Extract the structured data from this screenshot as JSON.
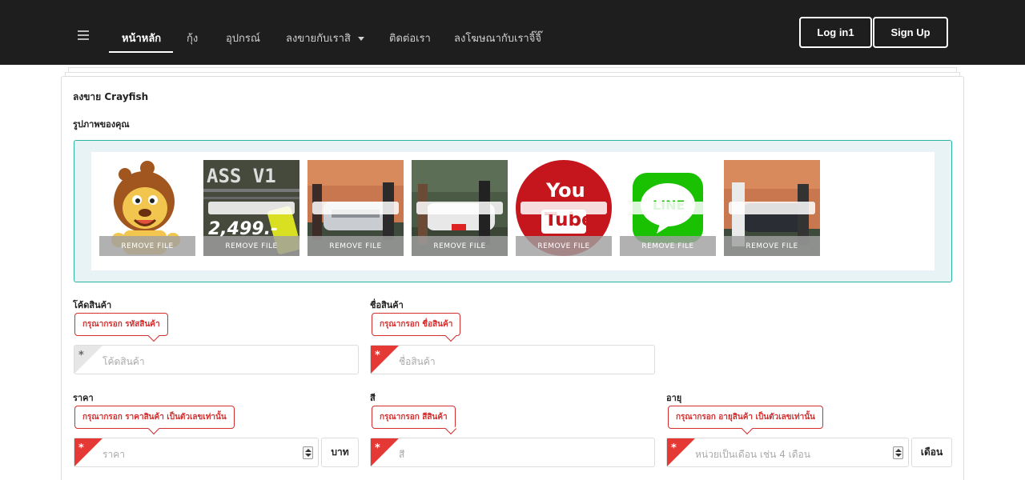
{
  "nav": {
    "items": [
      "หน้าหลัก",
      "กุ้ง",
      "อุปกรณ์",
      "ลงขายกับเราสิ",
      "ติดต่อเรา",
      "ลงโฆษณากับเราจิ๊จิ๊"
    ],
    "login": "Log in1",
    "signup": "Sign Up"
  },
  "card": {
    "title": "ลงขาย Crayfish",
    "images_label": "รูปภาพของคุณ"
  },
  "upload": {
    "remove_label": "REMOVE FILE",
    "thumbs": [
      {
        "kind": "lion-mascot"
      },
      {
        "kind": "product-ad",
        "text1": "ASS V1",
        "text2": "2,499.-"
      },
      {
        "kind": "car-photo"
      },
      {
        "kind": "car-photo"
      },
      {
        "kind": "youtube-logo",
        "text1": "You",
        "text2": "Tube"
      },
      {
        "kind": "line-logo",
        "text1": "LINE"
      },
      {
        "kind": "car-photo"
      }
    ]
  },
  "form": {
    "code": {
      "label": "โค้ดสินค้า",
      "tip": "กรุณากรอก รหัสสินค้า",
      "placeholder": "โค้ดสินค้า"
    },
    "name": {
      "label": "ชื่อสินค้า",
      "tip": "กรุณากรอก ชื่อสินค้า",
      "placeholder": "ชื่อสินค้า"
    },
    "price": {
      "label": "ราคา",
      "tip": "กรุณากรอก ราคาสินค้า เป็นตัวเลขเท่านั้น",
      "placeholder": "ราคา",
      "addon": "บาท"
    },
    "color": {
      "label": "สี",
      "tip": "กรุณากรอก สีสินค้า",
      "placeholder": "สี"
    },
    "age": {
      "label": "อายุ",
      "tip": "กรุณากรอก อายุสินค้า เป็นตัวเลขเท่านั้น",
      "placeholder": "หน่วยเป็นเดือน เช่น 4 เดือน",
      "addon": "เดือน"
    },
    "required_mark": "*"
  },
  "colors": {
    "navbar": "#1e1e1e",
    "accent_teal": "#2bb3a3",
    "error_red": "#d32f2f"
  }
}
